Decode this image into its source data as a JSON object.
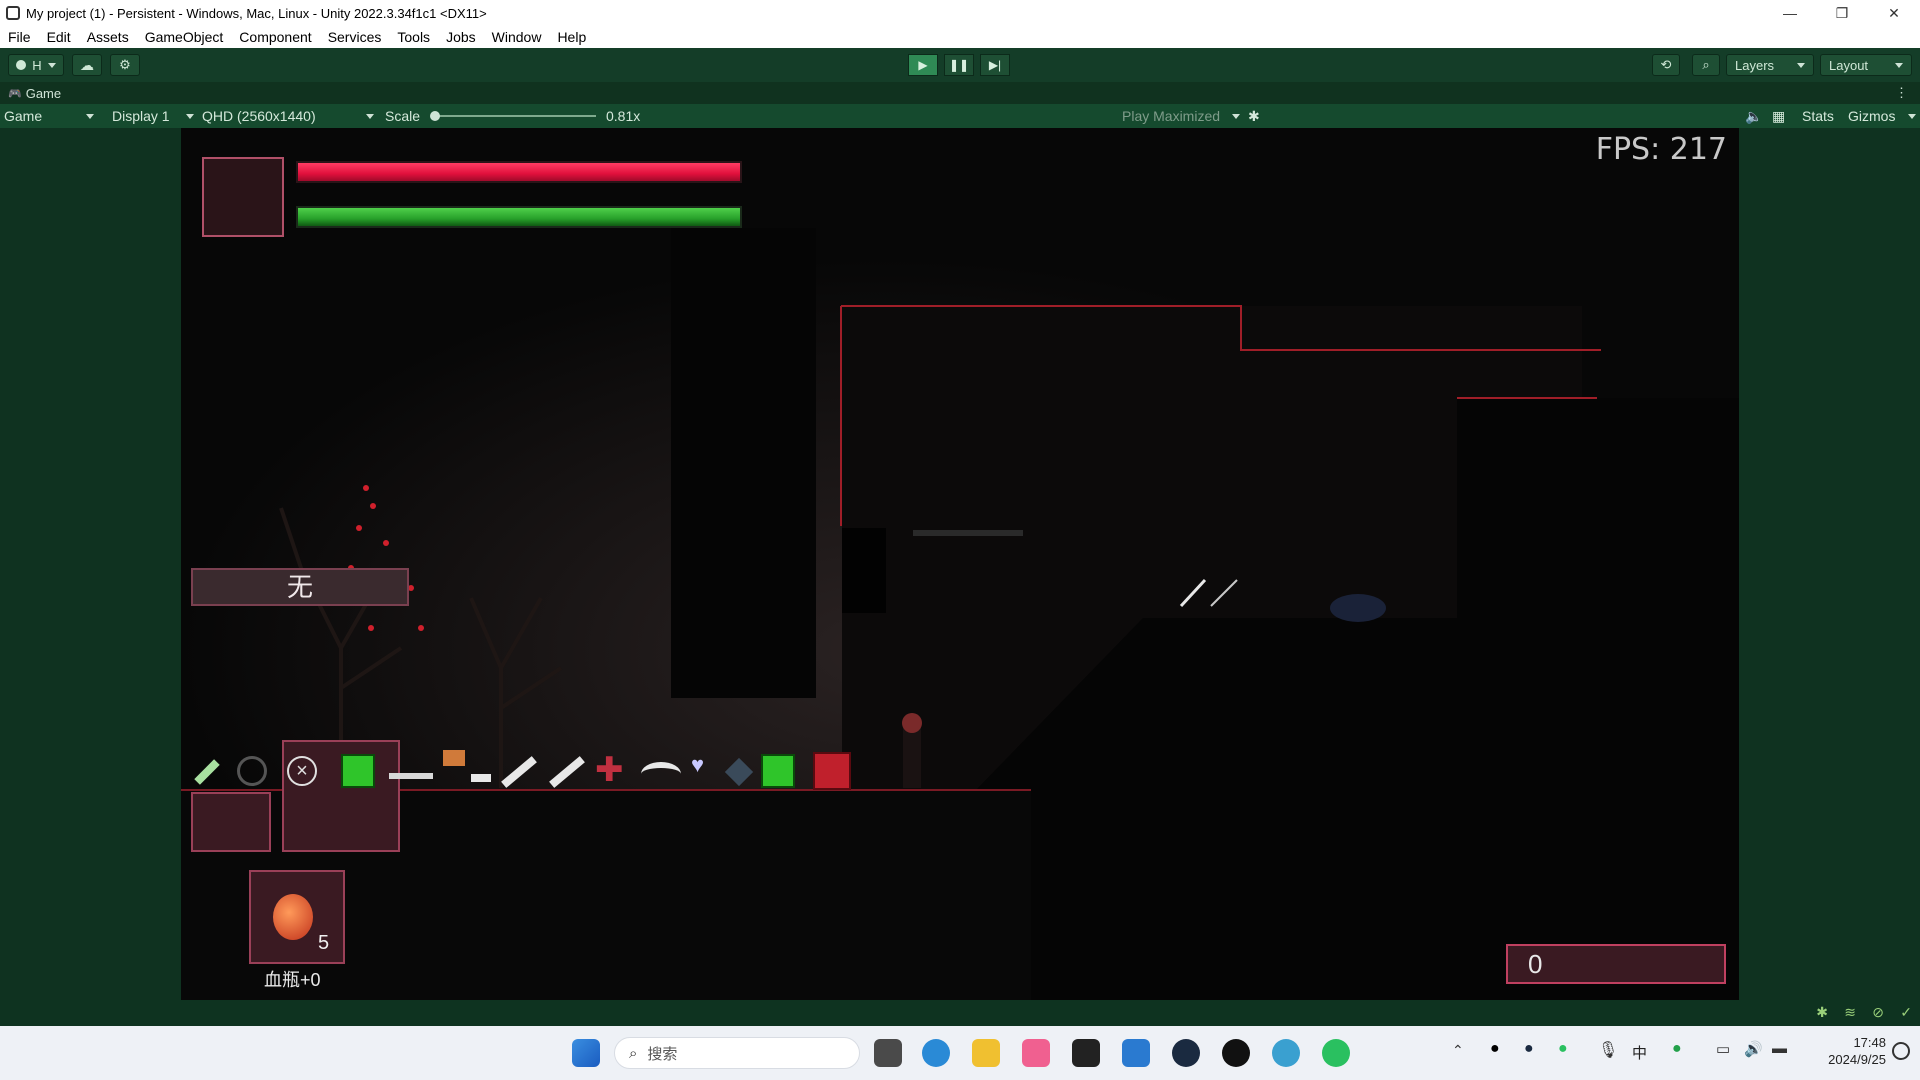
{
  "window": {
    "title": "My project (1) - Persistent - Windows, Mac, Linux - Unity 2022.3.34f1c1 <DX11>",
    "controls": [
      "—",
      "❐",
      "✕"
    ]
  },
  "menu": [
    "File",
    "Edit",
    "Assets",
    "GameObject",
    "Component",
    "Services",
    "Tools",
    "Jobs",
    "Window",
    "Help"
  ],
  "toolbar": {
    "account_label": "H",
    "layers_label": "Layers",
    "layout_label": "Layout"
  },
  "game_tab": {
    "label": "Game"
  },
  "game_controls": {
    "mode": "Game",
    "display": "Display 1",
    "resolution": "QHD (2560x1440)",
    "scale_label": "Scale",
    "scale_value": "0.81x",
    "play_mode": "Play Maximized",
    "stats": "Stats",
    "gizmos": "Gizmos"
  },
  "hud": {
    "fps": "FPS: 217",
    "hp_fraction": 1.0,
    "stamina_fraction": 1.0,
    "skill_text": "无",
    "potion_count": "5",
    "potion_label": "血瓶+0",
    "score": "0"
  },
  "taskbar": {
    "search_placeholder": "搜索",
    "ime": "中",
    "time": "17:48",
    "date": "2024/9/25"
  },
  "colors": {
    "unity_toolbar": "#143d28",
    "unity_control": "#154a2e",
    "hp": "#e0103c",
    "stamina": "#27a02a",
    "hud_border": "#9a4058"
  }
}
